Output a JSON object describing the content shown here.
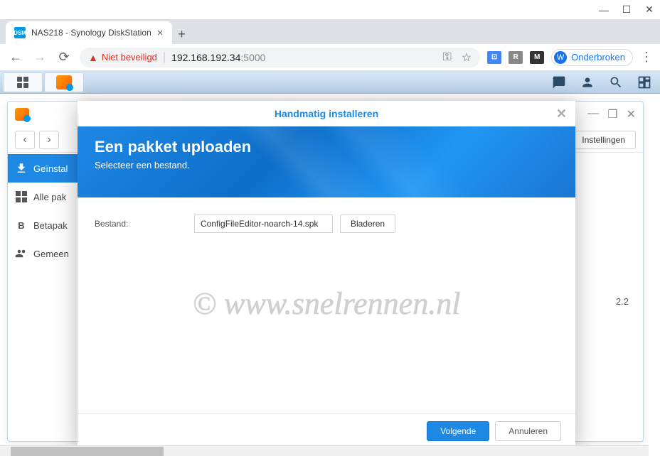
{
  "browser": {
    "tab_title": "NAS218 - Synology DiskStation",
    "favicon_text": "DSM",
    "security_text": "Niet beveiligd",
    "address_host": "192.168.192.34",
    "address_port": ":5000",
    "profile_initial": "W",
    "profile_label": "Onderbroken",
    "ext_badges": [
      "⊡",
      "R",
      "M"
    ]
  },
  "dsm": {
    "settings_btn": "Instellingen",
    "version_hint": "2.2",
    "sidebar": {
      "installed": "Geïnstal",
      "all": "Alle pak",
      "beta": "Betapak",
      "community": "Gemeen"
    }
  },
  "modal": {
    "title": "Handmatig installeren",
    "banner_title": "Een pakket uploaden",
    "banner_sub": "Selecteer een bestand.",
    "file_label": "Bestand:",
    "file_value": "ConfigFileEditor-noarch-14.spk",
    "browse": "Bladeren",
    "next": "Volgende",
    "cancel": "Annuleren"
  },
  "watermark": "© www.snelrennen.nl"
}
